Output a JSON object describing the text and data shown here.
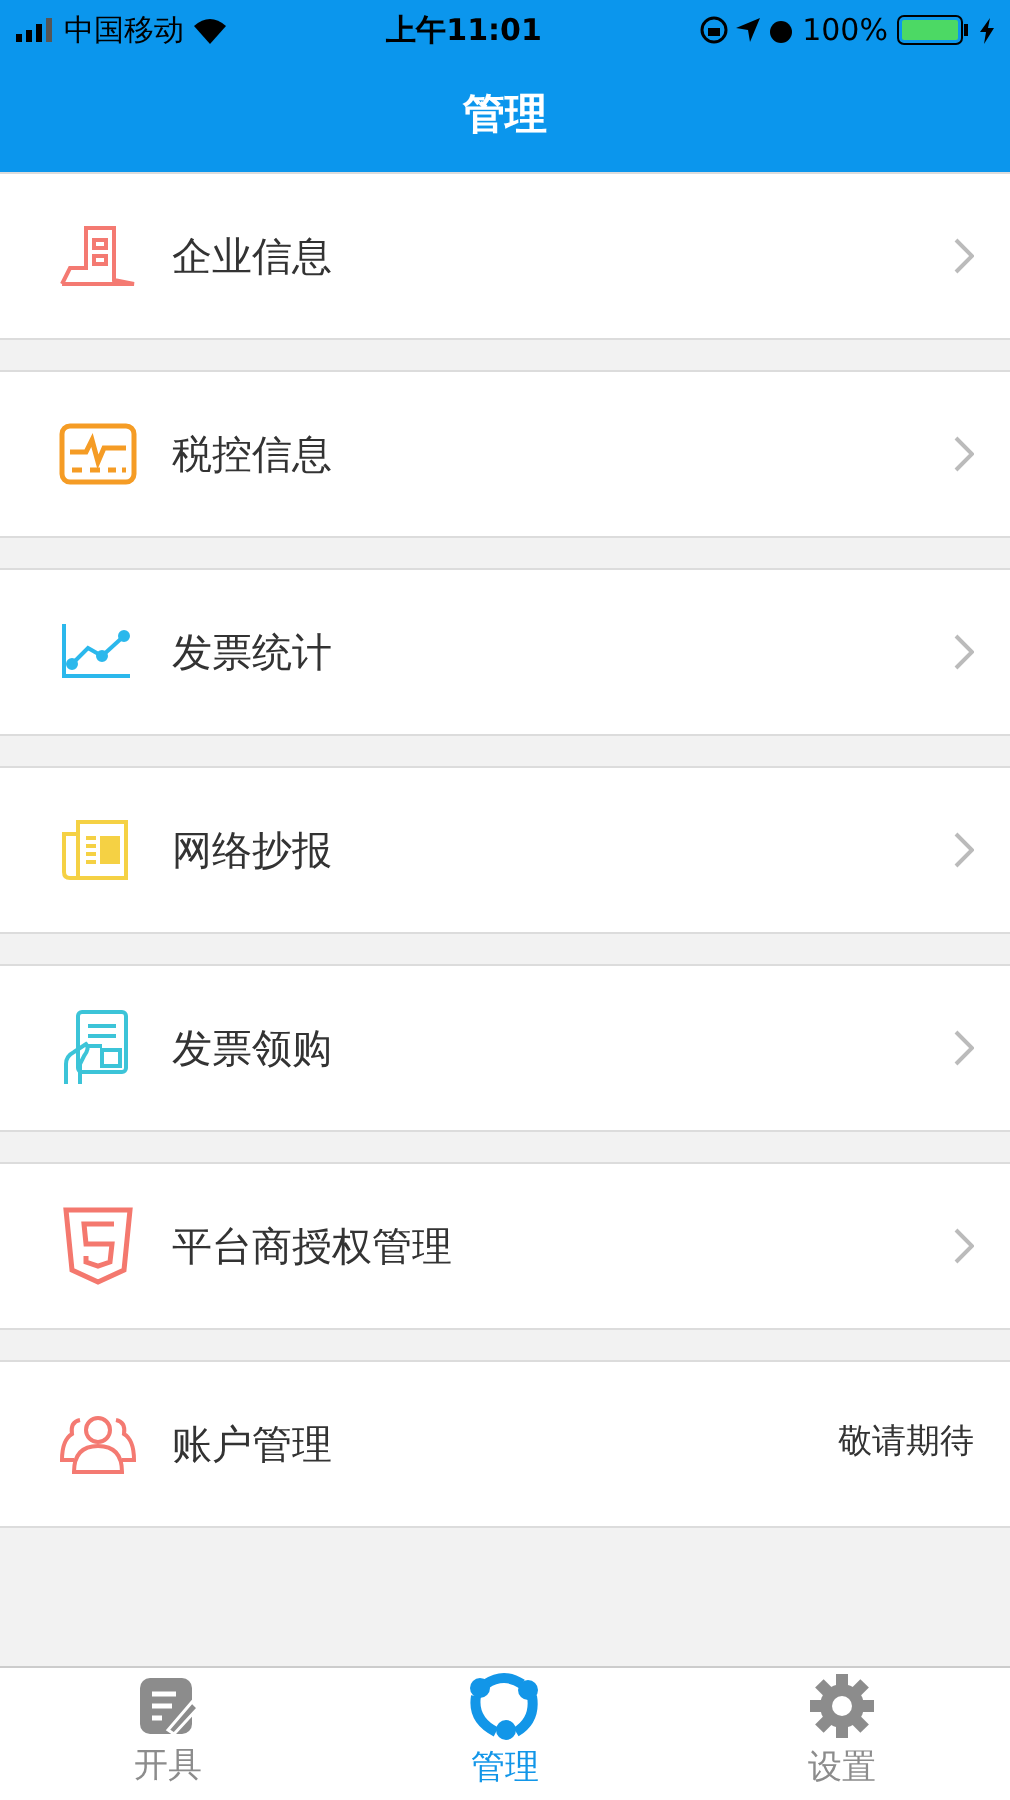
{
  "status_bar": {
    "carrier": "中国移动",
    "time": "上午11:01",
    "battery": "100%"
  },
  "header": {
    "title": "管理"
  },
  "menu": [
    {
      "label": "企业信息",
      "kind": "link"
    },
    {
      "label": "税控信息",
      "kind": "link"
    },
    {
      "label": "发票统计",
      "kind": "link"
    },
    {
      "label": "网络抄报",
      "kind": "link"
    },
    {
      "label": "发票领购",
      "kind": "link"
    },
    {
      "label": "平台商授权管理",
      "kind": "link"
    },
    {
      "label": "账户管理",
      "kind": "note",
      "note": "敬请期待"
    }
  ],
  "tabs": [
    {
      "label": "开具",
      "selected": false
    },
    {
      "label": "管理",
      "selected": true
    },
    {
      "label": "设置",
      "selected": false
    }
  ]
}
